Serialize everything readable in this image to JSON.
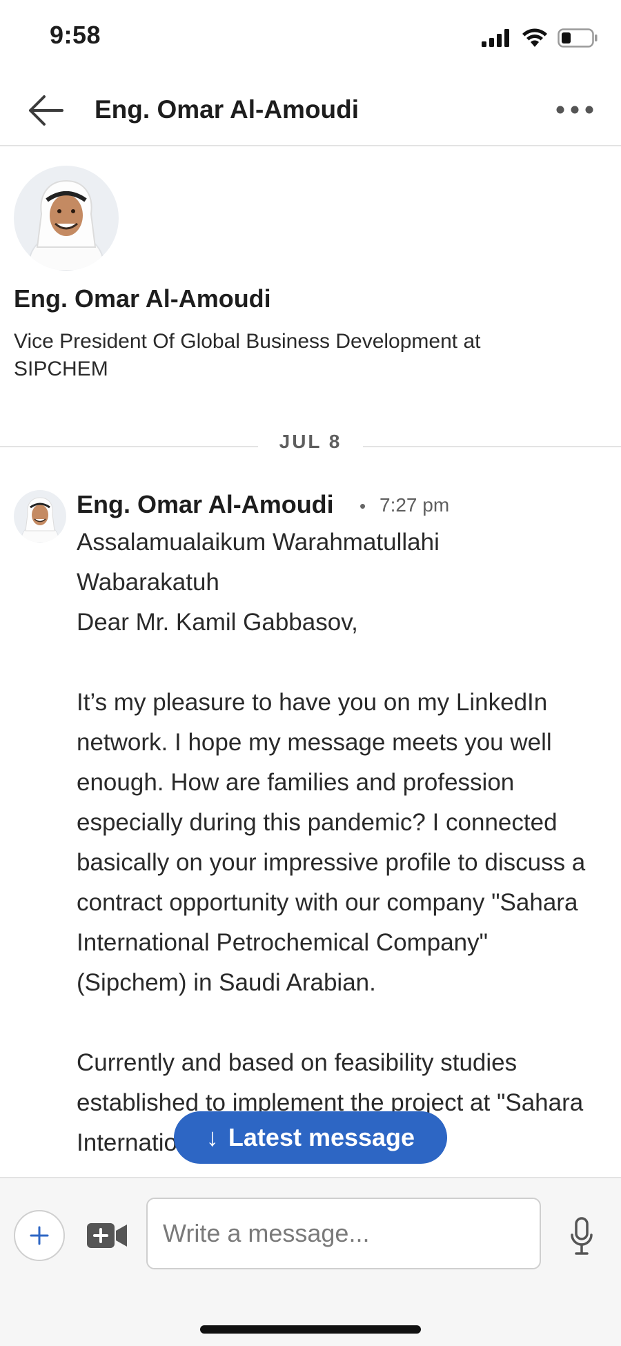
{
  "status_bar": {
    "time": "9:58"
  },
  "header": {
    "title": "Eng. Omar Al-Amoudi"
  },
  "profile": {
    "name": "Eng. Omar Al-Amoudi",
    "headline": "Vice President Of Global Business Development at SIPCHEM"
  },
  "date_divider": "JUL 8",
  "message": {
    "sender": "Eng. Omar Al-Amoudi",
    "separator": "•",
    "time": "7:27 pm",
    "paragraphs": [
      "Assalamualaikum Warahmatullahi Wabarakatuh",
      "Dear Mr. Kamil Gabbasov,",
      "It’s my pleasure to have you on my LinkedIn network. I hope my message meets you well enough. How are families and profession especially during this pandemic? I connected basically on your impressive profile to discuss a contract opportunity with our company \"Sahara International Petrochemical Company\" (Sipchem) in Saudi Arabian.",
      "Currently and based on feasibility studies established to implement the project at \"Sahara International Petrochemical"
    ]
  },
  "latest_button": {
    "arrow": "↓",
    "label": "Latest message"
  },
  "composer": {
    "placeholder": "Write a message..."
  },
  "colors": {
    "accent": "#2d66c4",
    "divider": "#e3e3e3",
    "text": "#1d1d1d"
  }
}
